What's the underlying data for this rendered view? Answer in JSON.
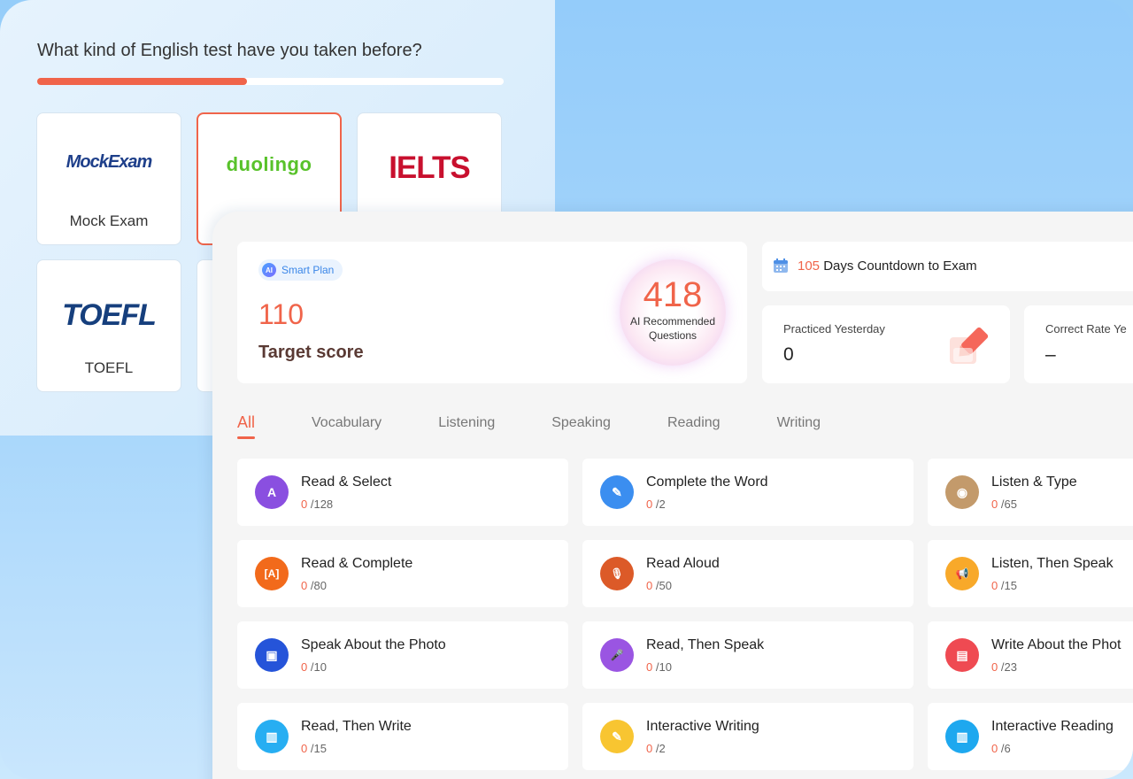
{
  "onboarding": {
    "question": "What kind of English test have you taken before?",
    "progress_percent": 45,
    "options": [
      {
        "logo": "MockExam",
        "name": "Mock Exam",
        "selected": false
      },
      {
        "logo": "duolingo",
        "name": "",
        "selected": true
      },
      {
        "logo": "IELTS",
        "name": "",
        "selected": false
      },
      {
        "logo": "TOEFL",
        "name": "TOEFL",
        "selected": false
      }
    ]
  },
  "smart_plan": {
    "badge_icon_text": "AI",
    "badge": "Smart Plan",
    "target_score": "110",
    "target_label": "Target score",
    "recommended_count": "418",
    "recommended_label": "AI Recommended Questions"
  },
  "countdown": {
    "icon": "calendar-icon",
    "days": "105",
    "text": " Days Countdown to Exam"
  },
  "stats": {
    "practiced_label": "Practiced Yesterday",
    "practiced_value": "0",
    "correct_label": "Correct Rate Ye",
    "correct_value": "–"
  },
  "tabs": [
    "All",
    "Vocabulary",
    "Listening",
    "Speaking",
    "Reading",
    "Writing"
  ],
  "active_tab": "All",
  "questions": [
    {
      "title": "Read & Select",
      "done": "0",
      "total": " /128",
      "color": "#8a4fe0",
      "icon": "A",
      "icon_name": "letter-a-icon"
    },
    {
      "title": "Complete the Word",
      "done": "0",
      "total": " /2",
      "color": "#3b8ef0",
      "icon": "✎",
      "icon_name": "document-edit-icon"
    },
    {
      "title": "Listen & Type",
      "done": "0",
      "total": " /65",
      "color": "#c39a6b",
      "icon": "◉",
      "icon_name": "audio-wave-icon"
    },
    {
      "title": "Read & Complete",
      "done": "0",
      "total": " /80",
      "color": "#f26a1b",
      "icon": "[A]",
      "icon_name": "bracket-a-icon"
    },
    {
      "title": "Read Aloud",
      "done": "0",
      "total": " /50",
      "color": "#dc5a28",
      "icon": "🎙",
      "icon_name": "microphone-icon"
    },
    {
      "title": "Listen, Then Speak",
      "done": "0",
      "total": " /15",
      "color": "#f8a92a",
      "icon": "📢",
      "icon_name": "megaphone-icon"
    },
    {
      "title": "Speak About the Photo",
      "done": "0",
      "total": " /10",
      "color": "#2554d9",
      "icon": "▣",
      "icon_name": "photo-chart-icon"
    },
    {
      "title": "Read, Then Speak",
      "done": "0",
      "total": " /10",
      "color": "#9a55e2",
      "icon": "🎤",
      "icon_name": "karaoke-mic-icon"
    },
    {
      "title": "Write About the Phot",
      "done": "0",
      "total": " /23",
      "color": "#ef4a52",
      "icon": "▤",
      "icon_name": "image-icon"
    },
    {
      "title": "Read, Then Write",
      "done": "0",
      "total": " /15",
      "color": "#27aef2",
      "icon": "▥",
      "icon_name": "document-icon"
    },
    {
      "title": "Interactive Writing",
      "done": "0",
      "total": " /2",
      "color": "#f8c531",
      "icon": "✎",
      "icon_name": "note-edit-icon"
    },
    {
      "title": "Interactive Reading",
      "done": "0",
      "total": " /6",
      "color": "#1ea8ef",
      "icon": "▥",
      "icon_name": "document-icon"
    }
  ]
}
